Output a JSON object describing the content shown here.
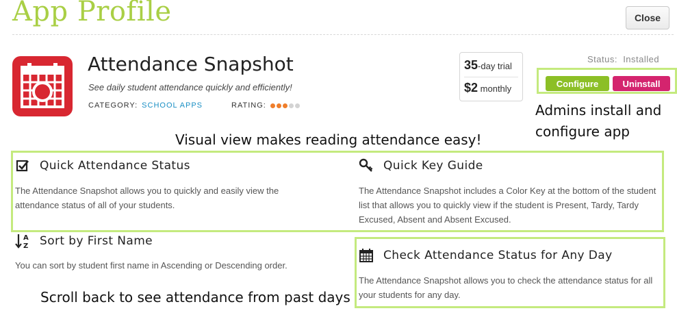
{
  "header": {
    "title": "App Profile",
    "close_label": "Close"
  },
  "app": {
    "name": "Attendance Snapshot",
    "description": "See daily student attendance quickly and efficiently!",
    "category_label": "CATEGORY:",
    "category_value": "SCHOOL APPS",
    "rating_label": "RATING:",
    "rating_value": "3 of 5",
    "icon": "calendar-icon"
  },
  "pricing": {
    "trial_number": "35",
    "trial_suffix": "-day trial",
    "price": "$2",
    "period": "monthly"
  },
  "status": {
    "text": "Status:  Installed",
    "configure_label": "Configure",
    "uninstall_label": "Uninstall"
  },
  "annotations": {
    "admin_line1": "Admins install and",
    "admin_line2": "configure app",
    "visual": "Visual view makes reading attendance easy!",
    "scroll": "Scroll back to see attendance from past days"
  },
  "features": [
    {
      "title": "Quick Attendance Status",
      "icon": "checkbox-icon",
      "body": "The Attendance Snapshot allows you to quickly and easily view the attendance status of all of your students."
    },
    {
      "title": "Quick Key Guide",
      "icon": "key-icon",
      "body": "The Attendance Snapshot includes a Color Key at the bottom of the student list that allows you to quickly view if the student is Present, Tardy, Tardy Excused, Absent and Absent Excused."
    },
    {
      "title": "Sort by First Name",
      "icon": "sort-az-icon",
      "body": "You can sort by student first name in Ascending or Descending order."
    },
    {
      "title": "Check Attendance Status for Any Day",
      "icon": "calendar-icon",
      "body": "The Attendance Snapshot allows you to check the attendance status for all your students for any day."
    }
  ],
  "colors": {
    "title_green": "#a9cf45",
    "highlight_green": "#c4ea7e",
    "configure_green": "#8cbf26",
    "uninstall_pink": "#d4246e",
    "icon_red": "#d82731",
    "link_blue": "#1a8fc4",
    "rating_orange": "#ef7e2b"
  }
}
